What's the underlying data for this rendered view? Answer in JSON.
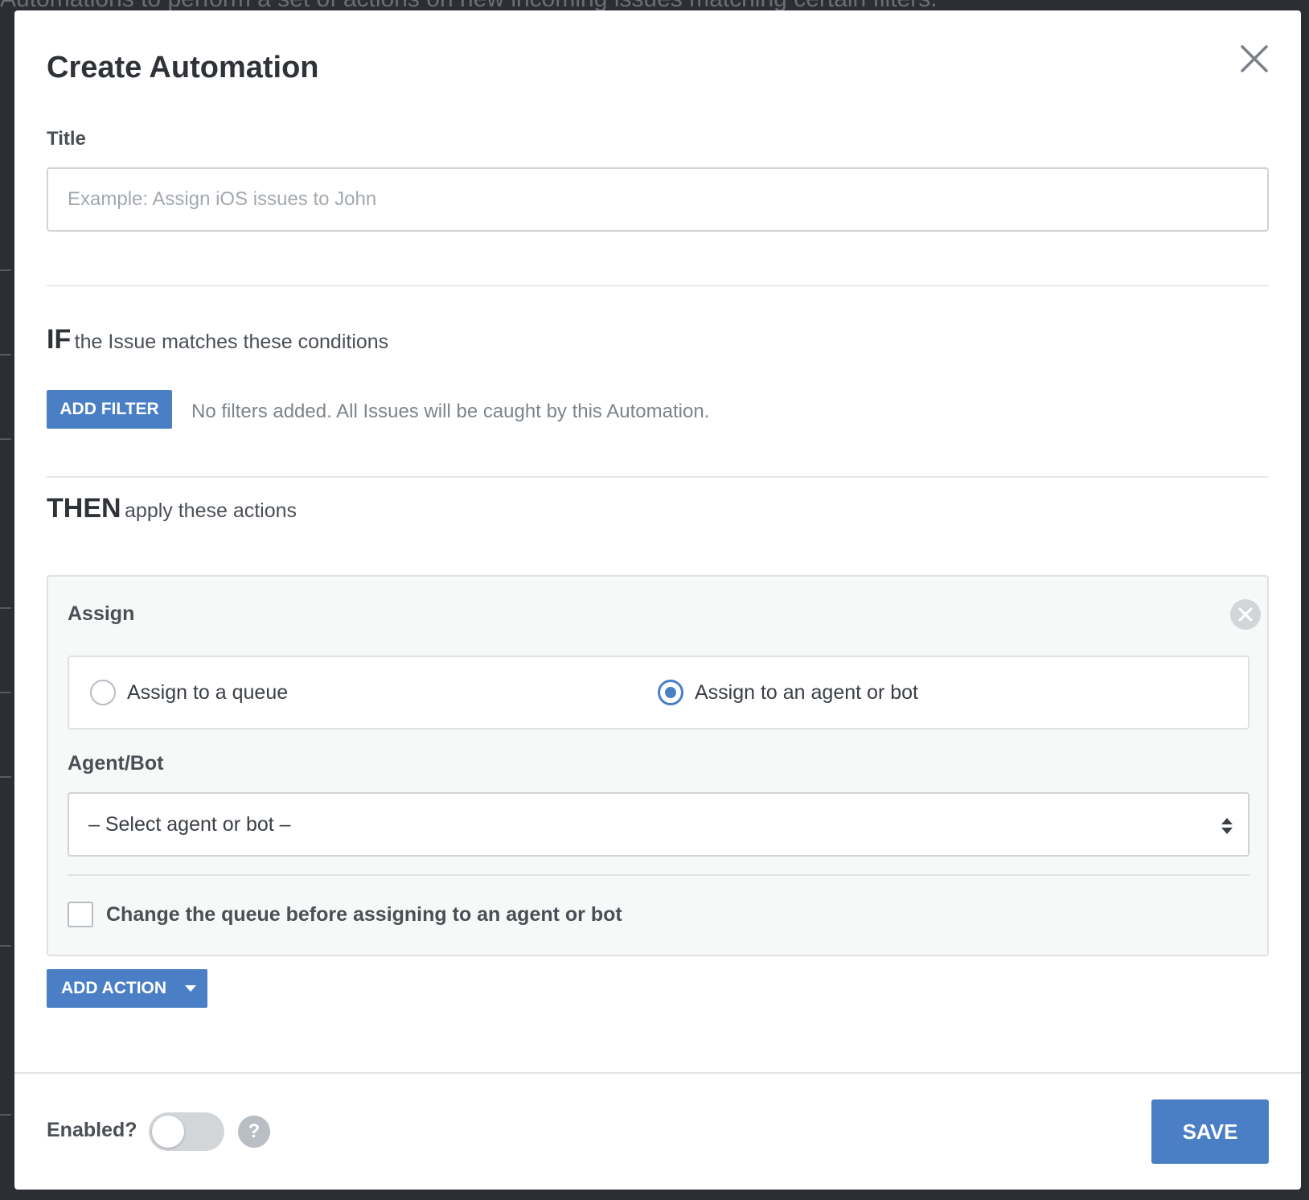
{
  "background": {
    "text": "Automations to perform a set of actions on new incoming issues matching certain filters."
  },
  "modal": {
    "title": "Create Automation",
    "close_icon": "close-icon"
  },
  "title_field": {
    "label": "Title",
    "value": "",
    "placeholder": "Example: Assign iOS issues to John"
  },
  "conditions": {
    "keyword": "IF",
    "text": "the Issue matches these conditions",
    "add_filter_label": "ADD FILTER",
    "empty_note": "No filters added. All Issues will be caught by this Automation."
  },
  "actions": {
    "keyword": "THEN",
    "text": "apply these actions",
    "card": {
      "title": "Assign",
      "remove_icon": "remove-circle-icon",
      "options": [
        {
          "label": "Assign to a queue",
          "selected": false
        },
        {
          "label": "Assign to an agent or bot",
          "selected": true
        }
      ],
      "agent_label": "Agent/Bot",
      "agent_select_value": "– Select agent or bot –",
      "select_icon": "sort-arrows-icon",
      "change_queue_label": "Change the queue before assigning to an agent or bot",
      "change_queue_checked": false
    },
    "add_action_label": "ADD ACTION",
    "add_action_icon": "caret-down-icon"
  },
  "footer": {
    "enabled_label": "Enabled?",
    "enabled": false,
    "help_glyph": "?",
    "save_label": "SAVE"
  },
  "colors": {
    "accent": "#4a7fc6",
    "overlay": "#2b2f33",
    "text": "#2f3337",
    "muted": "#7d848b"
  }
}
